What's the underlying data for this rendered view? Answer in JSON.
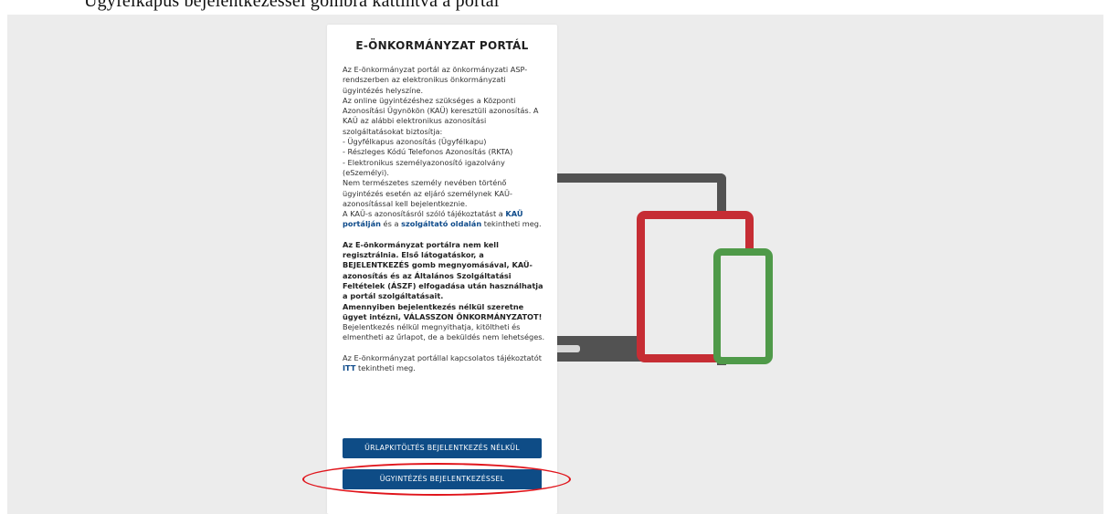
{
  "top_strip": {
    "cut_text": "Ügyfélkapus bejelentkezéssel gombra kattintva a portál"
  },
  "portal": {
    "title": "E-ÖNKORMÁNYZAT PORTÁL",
    "intro_lines": [
      "Az E-önkormányzat portál  az önkormányzati ASP-rendszerben az elektronikus önkormányzati ügyintézés helyszíne.",
      "Az online ügyintézéshez szükséges a Központi Azonosítási Ügynökön (KAÜ) keresztüli azonosítás. A KAÜ az alábbi elektronikus azonosítási szolgáltatásokat biztosítja:",
      "- Ügyfélkapus azonosítás (Ügyfélkapu)",
      "- Részleges Kódú Telefonos Azonosítás (RKTA)",
      "- Elektronikus személyazonosító igazolvány (eSzemélyi).",
      "Nem természetes személy nevében történő ügyintézés esetén az eljáró személynek KAÜ-azonosítással kell bejelentkeznie."
    ],
    "kau_info": {
      "prefix": "A KAÜ-s azonosításról szóló tájékoztatást a ",
      "link1": "KAÜ portálján",
      "middle": " és a ",
      "link2": "szolgáltató oldalán",
      "suffix": " tekintheti meg."
    },
    "bold_registration": "Az E-önkormányzat portálra nem kell regisztrálnia. Első látogatáskor, a BEJELENTKEZÉS gomb megnyomásával, KAÜ-azonosítás és az Általános Szolgáltatási Feltételek (ÁSZF) elfogadása után használhatja a portál szolgáltatásait.",
    "bold_no_login": "Amennyiben bejelentkezés nélkül szeretne ügyet intézni, VÁLASSZON ÖNKORMÁNYZATOT!",
    "no_login_text": " Bejelentkezés nélkül megnyithatja, kitöltheti és elmentheti az űrlapot, de a beküldés nem lehetséges.",
    "more_info": {
      "prefix": "Az E-önkormányzat portállal kapcsolatos tájékoztatót ",
      "link": "ITT",
      "suffix": " tekintheti meg."
    },
    "btn_form_without_login": "ŰRLAPKITÖLTÉS BEJELENTKEZÉS NÉLKÜL",
    "btn_login": "ÜGYINTÉZÉS BEJELENTKEZÉSSEL"
  },
  "colors": {
    "button_blue": "#0e4c86",
    "link_blue": "#0d4a8a",
    "highlight_red": "#e0151c",
    "laptop_gray": "#525252",
    "tablet_red": "#c62d34",
    "phone_green": "#4f9a49"
  }
}
